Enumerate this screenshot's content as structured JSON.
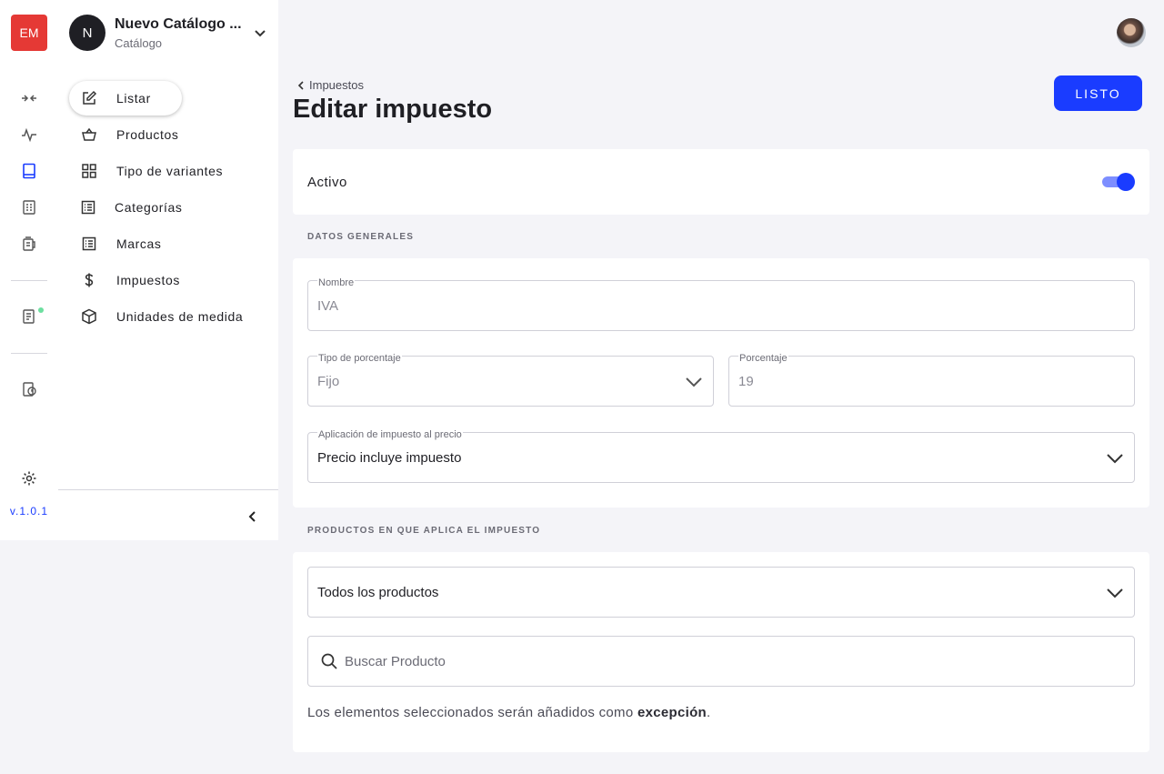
{
  "app": {
    "logo": "EM",
    "version": "v.1.0.1"
  },
  "rail": {
    "icons": [
      "switch-icon",
      "activity-icon",
      "book-icon",
      "checklist-icon",
      "register-icon",
      "receipt-icon",
      "billing-clock-icon",
      "gear-icon"
    ]
  },
  "catalog": {
    "avatar": "N",
    "title": "Nuevo Catálogo ...",
    "subtitle": "Catálogo"
  },
  "sidebar": {
    "items": [
      {
        "label": "Listar",
        "icon": "edit-icon",
        "active": true
      },
      {
        "label": "Productos",
        "icon": "basket-icon"
      },
      {
        "label": "Tipo de variantes",
        "icon": "grid-icon"
      },
      {
        "label": "Categorías",
        "icon": "list-icon"
      },
      {
        "label": "Marcas",
        "icon": "list-icon"
      },
      {
        "label": "Impuestos",
        "icon": "dollar-icon"
      },
      {
        "label": "Unidades de medida",
        "icon": "box-icon"
      }
    ]
  },
  "header": {
    "back_label": "Impuestos",
    "title": "Editar impuesto",
    "done_button": "LISTO"
  },
  "status": {
    "label": "Activo",
    "enabled": true
  },
  "general": {
    "section_title": "DATOS GENERALES",
    "name": {
      "label": "Nombre",
      "value": "IVA"
    },
    "percent_type": {
      "label": "Tipo de porcentaje",
      "value": "Fijo"
    },
    "percent": {
      "label": "Porcentaje",
      "value": "19"
    },
    "application": {
      "label": "Aplicación de impuesto al precio",
      "value": "Precio incluye impuesto"
    }
  },
  "products": {
    "section_title": "PRODUCTOS EN QUE APLICA EL IMPUESTO",
    "scope": {
      "value": "Todos los productos"
    },
    "search": {
      "placeholder": "Buscar Producto"
    },
    "note_prefix": "Los elementos seleccionados serán añadidos como ",
    "note_bold": "excepción",
    "note_suffix": "."
  },
  "colors": {
    "accent": "#1a3cff",
    "logo": "#e53935",
    "background": "#f4f4f8"
  }
}
